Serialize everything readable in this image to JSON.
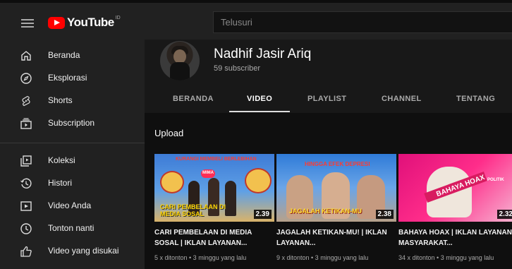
{
  "topbar": {
    "logo_text": "YouTube",
    "logo_sup": "ID",
    "search_placeholder": "Telusuri"
  },
  "sidebar": {
    "items": [
      {
        "label": "Beranda",
        "icon": "home-icon"
      },
      {
        "label": "Eksplorasi",
        "icon": "compass-icon"
      },
      {
        "label": "Shorts",
        "icon": "shorts-icon"
      },
      {
        "label": "Subscription",
        "icon": "subscriptions-icon"
      },
      {
        "label": "Koleksi",
        "icon": "library-icon"
      },
      {
        "label": "Histori",
        "icon": "history-icon"
      },
      {
        "label": "Video Anda",
        "icon": "your-videos-icon"
      },
      {
        "label": "Tonton nanti",
        "icon": "clock-icon"
      },
      {
        "label": "Video yang disukai",
        "icon": "thumbs-up-icon"
      }
    ]
  },
  "channel": {
    "name": "Nadhif Jasir Ariq",
    "subscribers": "59 subscriber"
  },
  "tabs": [
    "BERANDA",
    "VIDEO",
    "PLAYLIST",
    "CHANNEL",
    "TENTANG"
  ],
  "active_tab": "VIDEO",
  "section_title": "Upload",
  "videos": [
    {
      "title": "CARI PEMBELAAN DI MEDIA SOSAL | IKLAN LAYANAN...",
      "meta": "5 x ditonton • 3 minggu yang lalu",
      "duration": "2.39",
      "thumb_caption": "CARI PEMBELAAN DI MEDIA SOSAL",
      "thumb_top": "KURANGI MEMBELI BERLEBIHAN",
      "thumb_badge": "MIMA"
    },
    {
      "title": "JAGALAH KETIKAN-MU! | IKLAN LAYANAN...",
      "meta": "9 x ditonton • 3 minggu yang lalu",
      "duration": "2.38",
      "thumb_top": "HINGGA EFEK DEPRESI",
      "thumb_caption": "JAGALAH KETIKAN-MU"
    },
    {
      "title": "BAHAYA HOAX | IKLAN LAYANAN MASYARAKAT...",
      "meta": "34 x ditonton • 3 minggu yang lalu",
      "duration": "2.32",
      "thumb_caption": "BAHAYA HOAX",
      "thumb_tag": "POLITIK"
    }
  ],
  "colors": {
    "brand_red": "#ff0000",
    "bg_topbar": "#212121",
    "bg_content": "#0f0f0f"
  }
}
